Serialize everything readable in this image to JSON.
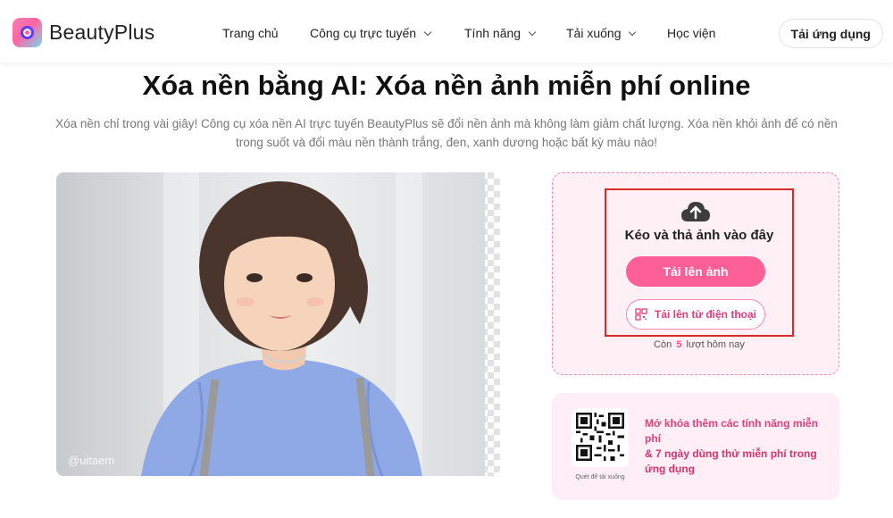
{
  "brand": {
    "name": "BeautyPlus",
    "accent": "#ff5f97"
  },
  "nav": {
    "items": [
      {
        "label": "Trang chủ",
        "dropdown": false
      },
      {
        "label": "Công cụ trực tuyến",
        "dropdown": true
      },
      {
        "label": "Tính năng",
        "dropdown": true
      },
      {
        "label": "Tải xuống",
        "dropdown": true
      },
      {
        "label": "Học viện",
        "dropdown": false
      }
    ],
    "download_label": "Tải ứng dụng"
  },
  "hero": {
    "title": "Xóa nền bằng AI: Xóa nền ảnh miễn phí online",
    "subtitle": "Xóa nền chỉ trong vài giây! Công cụ xóa nền AI trực tuyến BeautyPlus sẽ đổi nền ảnh mà không làm giảm chất lượng. Xóa nền khỏi ảnh để có nền trong suốt và đổi màu nền thành trắng, đen, xanh dương hoặc bất kỳ màu nào!"
  },
  "preview": {
    "watermark": "@uitaem"
  },
  "upload": {
    "icon": "cloud-upload-icon",
    "drag_text": "Kéo và thả ảnh vào đây",
    "upload_label": "Tải lên ảnh",
    "phone_label": "Tải lên từ điện thoại",
    "remaining_prefix": "Còn",
    "remaining_count": "5",
    "remaining_suffix": "lượt hôm nay"
  },
  "promo": {
    "qr_caption": "Quét để tải xuống",
    "line1": "Mở khóa thêm các tính năng miễn phí",
    "line2": "& 7 ngày dùng thử miễn phí trong ứng dụng"
  }
}
